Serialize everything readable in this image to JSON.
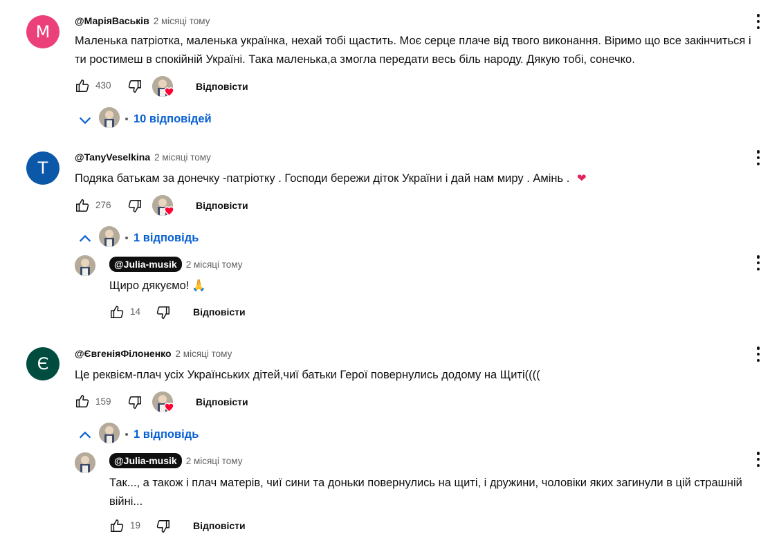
{
  "comments": [
    {
      "avatar_letter": "M",
      "avatar_color": "#ec407a",
      "author": "@МаріяВаськів",
      "time": "2 місяці тому",
      "text": "Маленька патріотка, маленька українка, нехай тобі щастить. Моє серце плаче від твого виконання. Віримо що все закінчиться і ти ростимеш в спокійній Україні. Така маленька,а змогла передати весь біль народу. Дякую тобі, сонечко.",
      "likes": "430",
      "reply_label": "Відповісти",
      "replies_label": "10 відповідей",
      "replies_expanded": false
    },
    {
      "avatar_letter": "T",
      "avatar_color": "#0b57a8",
      "author": "@TanyVeselkina",
      "time": "2 місяці тому",
      "text": "Подяка батькам за донечку -патріотку . Господи бережи діток України і дай нам миру . Амінь .",
      "emoji": "❤",
      "likes": "276",
      "reply_label": "Відповісти",
      "replies_label": "1 відповідь",
      "replies_expanded": true,
      "reply": {
        "author": "@Julia-musik",
        "time": "2 місяці тому",
        "text": "Щиро дякуємо!",
        "emoji": "🙏",
        "likes": "14",
        "reply_label": "Відповісти"
      }
    },
    {
      "avatar_letter": "Є",
      "avatar_color": "#004d40",
      "author": "@ЄвгеніяФілоненко",
      "time": "2 місяці тому",
      "text": "Це реквієм-плач усіх Українських дітей,чиї батьки Герої повернулись додому на Щиті((((",
      "likes": "159",
      "reply_label": "Відповісти",
      "replies_label": "1 відповідь",
      "replies_expanded": true,
      "reply": {
        "author": "@Julia-musik",
        "time": "2 місяці тому",
        "text": "Так..., а також і плач матерів, чиї сини та доньки повернулись на щиті, і дружини, чоловіки яких загинули в цій страшній війні...",
        "likes": "19",
        "reply_label": "Відповісти"
      }
    }
  ],
  "icons": {
    "like": "thumbs-up-icon",
    "dislike": "thumbs-down-icon",
    "menu": "more-vertical-icon",
    "expand": "chevron-down-icon",
    "collapse": "chevron-up-icon",
    "creator_heart": "heart-icon"
  },
  "colors": {
    "link_blue": "#065fd4",
    "heart_red": "#ff0033"
  }
}
